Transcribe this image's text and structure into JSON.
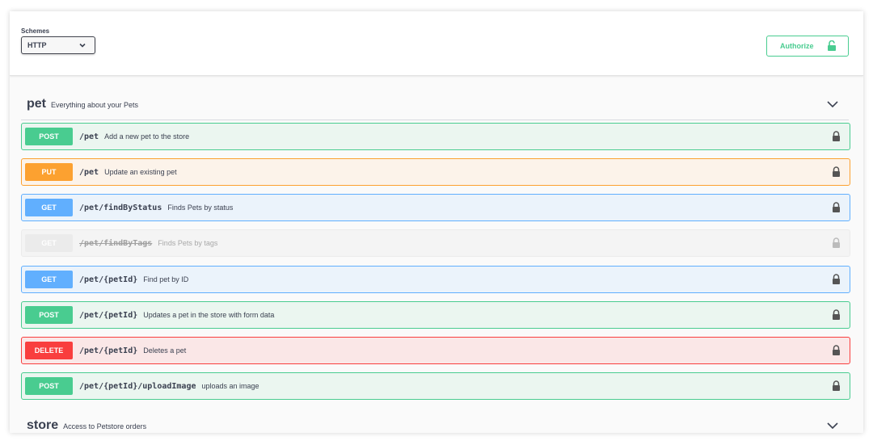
{
  "schemes": {
    "label": "Schemes",
    "selected": "HTTP"
  },
  "authorize": {
    "label": "Authorize"
  },
  "tags": [
    {
      "name": "pet",
      "description": "Everything about your Pets"
    },
    {
      "name": "store",
      "description": "Access to Petstore orders"
    }
  ],
  "operations": [
    {
      "method": "POST",
      "path": "/pet",
      "summary": "Add a new pet to the store"
    },
    {
      "method": "PUT",
      "path": "/pet",
      "summary": "Update an existing pet"
    },
    {
      "method": "GET",
      "path": "/pet/findByStatus",
      "summary": "Finds Pets by status"
    },
    {
      "method": "GET",
      "path": "/pet/findByTags",
      "summary": "Finds Pets by tags",
      "deprecated": true
    },
    {
      "method": "GET",
      "path": "/pet/{petId}",
      "summary": "Find pet by ID"
    },
    {
      "method": "POST",
      "path": "/pet/{petId}",
      "summary": "Updates a pet in the store with form data"
    },
    {
      "method": "DELETE",
      "path": "/pet/{petId}",
      "summary": "Deletes a pet"
    },
    {
      "method": "POST",
      "path": "/pet/{petId}/uploadImage",
      "summary": "uploads an image"
    }
  ],
  "colors": {
    "post": "#49cc90",
    "put": "#fca130",
    "get": "#61affe",
    "delete": "#f93e3e",
    "deprecated": "#ebebeb"
  },
  "icons": {
    "lock": "lock-icon",
    "chevron": "chevron-down-icon"
  }
}
